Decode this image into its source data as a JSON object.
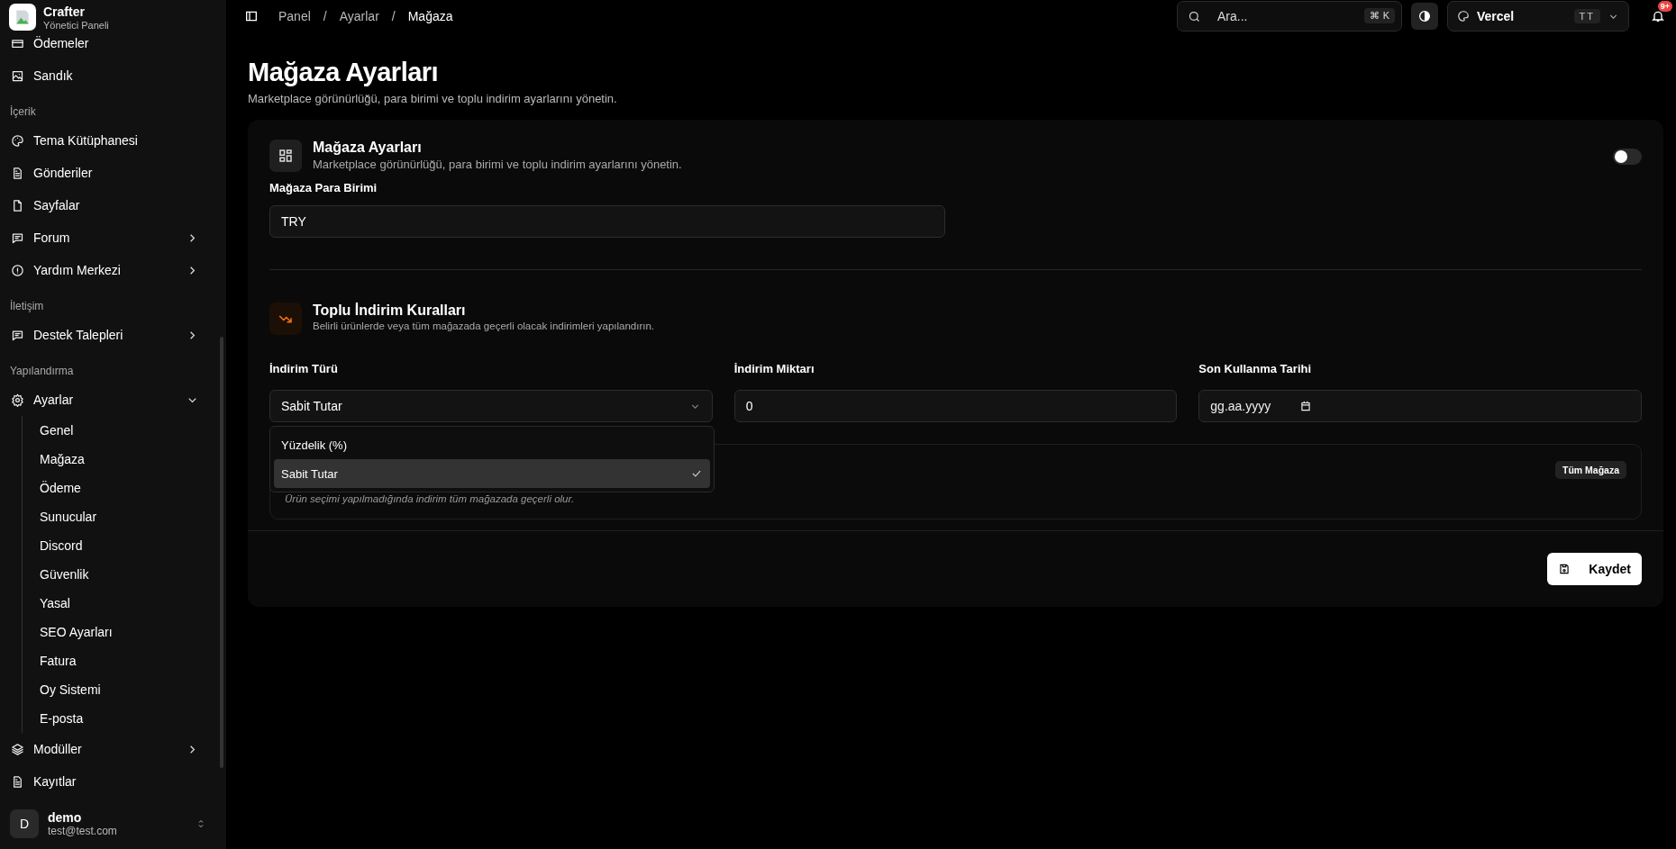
{
  "sidebar": {
    "brand": {
      "name": "Crafter",
      "subtitle": "Yönetici Paneli"
    },
    "items": [
      {
        "kind": "item",
        "label": "Ödemeler"
      },
      {
        "kind": "item",
        "label": "Sandık"
      },
      {
        "kind": "section",
        "label": "İçerik"
      },
      {
        "kind": "item",
        "label": "Tema Kütüphanesi"
      },
      {
        "kind": "item",
        "label": "Gönderiler"
      },
      {
        "kind": "item",
        "label": "Sayfalar"
      },
      {
        "kind": "item",
        "label": "Forum",
        "expanded": false
      },
      {
        "kind": "item",
        "label": "Yardım Merkezi",
        "expanded": false
      },
      {
        "kind": "section",
        "label": "İletişim"
      },
      {
        "kind": "item",
        "label": "Destek Talepleri",
        "expanded": false
      },
      {
        "kind": "section",
        "label": "Yapılandırma"
      },
      {
        "kind": "item",
        "label": "Ayarlar",
        "expanded": true,
        "children": [
          "Genel",
          "Mağaza",
          "Ödeme",
          "Sunucular",
          "Discord",
          "Güvenlik",
          "Yasal",
          "SEO Ayarları",
          "Fatura",
          "Oy Sistemi",
          "E-posta"
        ]
      },
      {
        "kind": "item",
        "label": "Modüller",
        "expanded": false
      },
      {
        "kind": "item",
        "label": "Kayıtlar"
      }
    ],
    "user": {
      "initial": "D",
      "name": "demo",
      "email": "test@test.com"
    }
  },
  "topbar": {
    "separator": "/",
    "breadcrumbs": [
      {
        "label": "Panel",
        "current": false
      },
      {
        "label": "Ayarlar",
        "current": false
      },
      {
        "label": "Mağaza",
        "current": true
      }
    ],
    "search": {
      "placeholder": "Ara...",
      "keys": [
        "⌘",
        "K"
      ]
    },
    "workspace": {
      "name": "Vercel",
      "badge": "TT"
    },
    "notifications": {
      "count": "9+"
    }
  },
  "page": {
    "title": "Mağaza Ayarları",
    "subtitle": "Marketplace görünürlüğü, para birimi ve toplu indirim ayarlarını yönetin."
  },
  "card": {
    "title": "Mağaza Ayarları",
    "subtitle": "Marketplace görünürlüğü, para birimi ve toplu indirim ayarlarını yönetin.",
    "toggle": {
      "on": false
    },
    "currency": {
      "label": "Mağaza Para Birimi",
      "value": "TRY"
    },
    "discount": {
      "title": "Toplu İndirim Kuralları",
      "subtitle": "Belirli ürünlerde veya tüm mağazada geçerli olacak indirimleri yapılandırın.",
      "fields": [
        {
          "kind": "select",
          "label": "İndirim Türü",
          "value": "Sabit Tutar",
          "expanded": true,
          "options": [
            {
              "label": "Yüzdelik (%)",
              "selected": false
            },
            {
              "label": "Sabit Tutar",
              "selected": true
            }
          ]
        },
        {
          "kind": "number",
          "label": "İndirim Miktarı",
          "value": "0"
        },
        {
          "kind": "date",
          "label": "Son Kullanma Tarihi",
          "placeholder": "gg.aa.yyyy"
        }
      ],
      "scope": {
        "badge": "Tüm Mağaza",
        "hint": "Ürün seçimi yapılmadığında indirim tüm mağazada geçerli olur."
      }
    },
    "save": "Kaydet"
  }
}
